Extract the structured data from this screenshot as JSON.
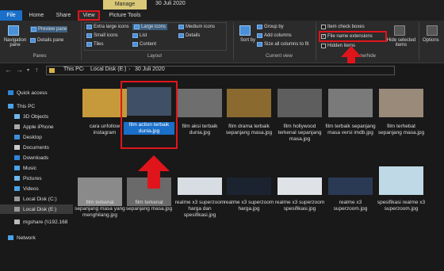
{
  "titlebar": {
    "manage": "Manage",
    "title": "30 Juli 2020"
  },
  "tabs": {
    "file": "File",
    "home": "Home",
    "share": "Share",
    "view": "View",
    "picture_tools": "Picture Tools"
  },
  "ribbon": {
    "navigation_pane": "Navigation pane",
    "preview_pane": "Preview pane",
    "details_pane": "Details pane",
    "panes_label": "Panes",
    "extra_large_icons": "Extra large icons",
    "large_icons": "Large icons",
    "medium_icons": "Medium icons",
    "small_icons": "Small icons",
    "list": "List",
    "details": "Details",
    "tiles": "Tiles",
    "content": "Content",
    "layout_label": "Layout",
    "sort_by": "Sort by",
    "group_by": "Group by",
    "add_columns": "Add columns",
    "size_all_columns": "Size all columns to fit",
    "current_view_label": "Current view",
    "item_check_boxes": "Item check boxes",
    "file_name_extensions": "File name extensions",
    "hidden_items": "Hidden items",
    "show_hide_label": "Show/hide",
    "hide_selected": "Hide selected items",
    "options": "Options"
  },
  "address": {
    "crumbs": [
      "This PC",
      "Local Disk (E:)",
      "30 Juli 2020"
    ]
  },
  "nav": {
    "items": [
      "Quick access",
      "This PC",
      "3D Objects",
      "Apple iPhone",
      "Desktop",
      "Documents",
      "Downloads",
      "Music",
      "Pictures",
      "Videos",
      "Local Disk (C:)",
      "Local Disk (E:)",
      "mgshare (\\\\192.168",
      "Network"
    ]
  },
  "files": [
    {
      "name": "cara unfollow instagram",
      "thumb": "#c69a3a"
    },
    {
      "name": "film action terbaik dunia.jpg",
      "thumb": "#3f4f66"
    },
    {
      "name": "film aksi terbaik dunia.jpg",
      "thumb": "#6e6e6e"
    },
    {
      "name": "film drama terbaik sepanjang masa.jpg",
      "thumb": "#8a6a2e"
    },
    {
      "name": "film hollywood terkenal sepanjang masa.jpg",
      "thumb": "#5e5e5e"
    },
    {
      "name": "film terbaik sepanjang masa versi imdb.jpg",
      "thumb": "#7a7a7a"
    },
    {
      "name": "film terhebat sepanjang masa.jpg",
      "thumb": "#9a8a7a"
    },
    {
      "name": "film terkenal sepanjang masa yang menghilang.jpg",
      "thumb": "#8a8a8a"
    },
    {
      "name": "film terkenal sepanjang masa.jpg",
      "thumb": "#6a6a6a"
    },
    {
      "name": "realme x3 superzoom harga dan spesifikasi.jpg",
      "thumb": "#d8dde3"
    },
    {
      "name": "realme x3 superzoom harga.jpg",
      "thumb": "#1c2330"
    },
    {
      "name": "realme x3 superzoom spesifikasi.jpg",
      "thumb": "#dfe3e8"
    },
    {
      "name": "realme x3 superzoom.jpg",
      "thumb": "#2a3a55"
    },
    {
      "name": "spesifikasi realme x3 superzoom.jpg",
      "thumb": "#bfd9e6"
    }
  ],
  "colors": {
    "accent": "#1a6fc9",
    "highlight": "#e0151b",
    "manage_tab": "#d8c877"
  }
}
